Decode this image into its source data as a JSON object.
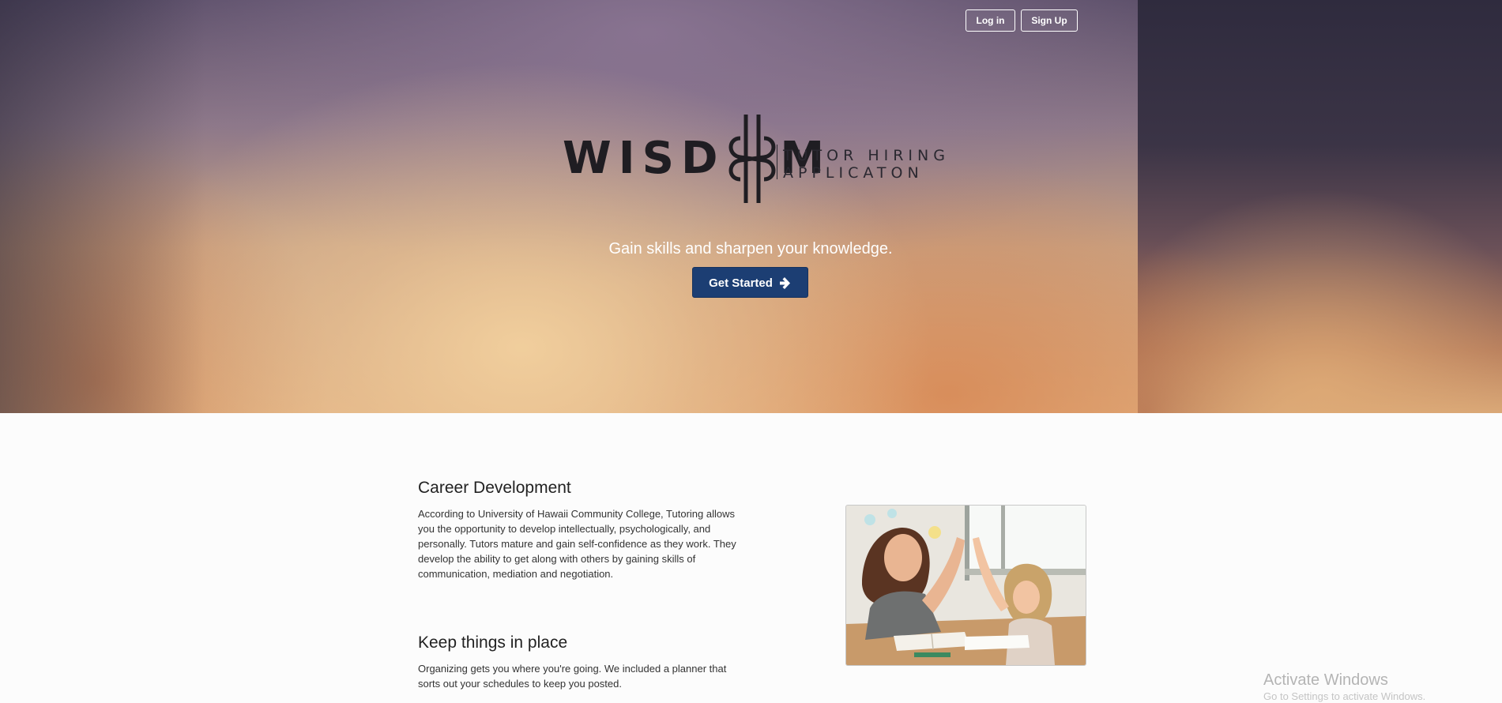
{
  "header": {
    "login_label": "Log in",
    "signup_label": "Sign Up"
  },
  "logo": {
    "word_left": "WISD",
    "word_right": "M",
    "sub_line1": "TUTOR HIRING",
    "sub_line2": "APPLICATON"
  },
  "hero": {
    "tagline": "Gain skills and sharpen your knowledge.",
    "cta_label": "Get Started",
    "cta_icon": "arrow-right-icon"
  },
  "sections": [
    {
      "title": "Career Development",
      "body": "According to University of Hawaii Community College, Tutoring allows you the opportunity to develop intellectually, psychologically, and personally. Tutors mature and gain self-confidence as they work. They develop the ability to get along with others by gaining skills of communication, mediation and negotiation."
    },
    {
      "title": "Keep things in place",
      "body": "Organizing gets you where you're going. We included a planner that sorts out your schedules to keep you posted."
    }
  ],
  "watermark": {
    "title": "Activate Windows",
    "subtitle": "Go to Settings to activate Windows."
  },
  "colors": {
    "cta_background": "#1c3e73",
    "logo_ink": "#1f1d22"
  }
}
